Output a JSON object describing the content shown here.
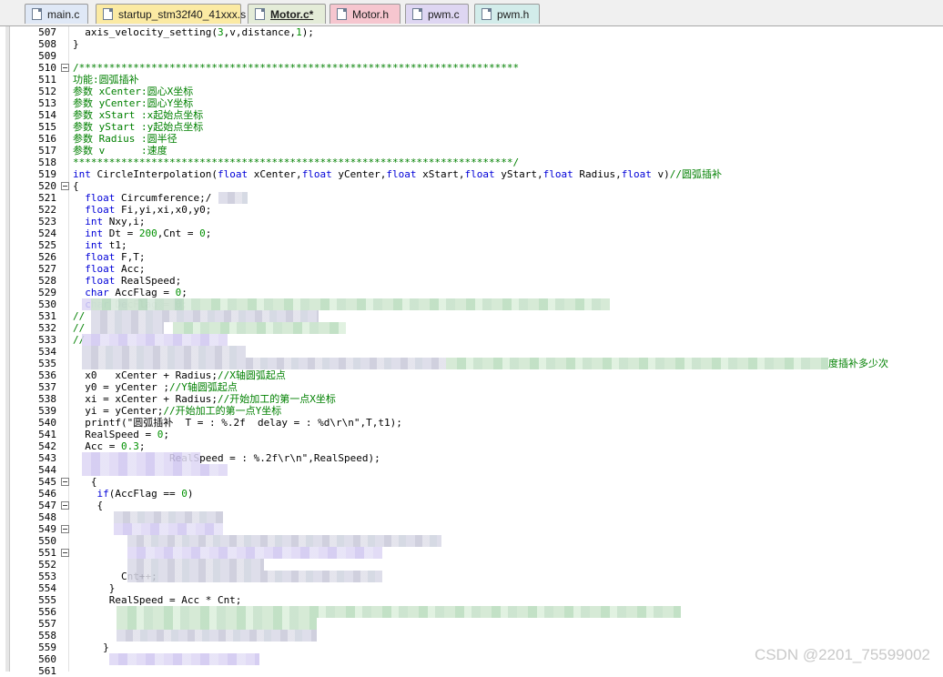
{
  "tabs": [
    {
      "label": "main.c",
      "bg": "#dfe8f6",
      "active": false
    },
    {
      "label": "startup_stm32f40_41xxx.s",
      "bg": "#fbeaa3",
      "active": false
    },
    {
      "label": "Motor.c*",
      "bg": "#e4ecd8",
      "active": true
    },
    {
      "label": "Motor.h",
      "bg": "#f6c6cf",
      "active": false
    },
    {
      "label": "pwm.c",
      "bg": "#ded6f2",
      "active": false
    },
    {
      "label": "pwm.h",
      "bg": "#d2ecea",
      "active": false
    }
  ],
  "lines": [
    {
      "n": "507",
      "fold": false,
      "html": "  axis_velocity_setting(<span class='num'>3</span>,v,distance,<span class='num'>1</span>);"
    },
    {
      "n": "508",
      "fold": false,
      "html": "}"
    },
    {
      "n": "509",
      "fold": false,
      "html": ""
    },
    {
      "n": "510",
      "fold": true,
      "html": "<span class='cm'>/*************************************************************************</span>"
    },
    {
      "n": "511",
      "fold": false,
      "html": "<span class='cm'>功能:圆弧插补</span>"
    },
    {
      "n": "512",
      "fold": false,
      "html": "<span class='cm'>参数 xCenter:圆心X坐标</span>"
    },
    {
      "n": "513",
      "fold": false,
      "html": "<span class='cm'>参数 yCenter:圆心Y坐标</span>"
    },
    {
      "n": "514",
      "fold": false,
      "html": "<span class='cm'>参数 xStart :x起始点坐标</span>"
    },
    {
      "n": "515",
      "fold": false,
      "html": "<span class='cm'>参数 yStart :y起始点坐标</span>"
    },
    {
      "n": "516",
      "fold": false,
      "html": "<span class='cm'>参数 Radius :圆半径</span>"
    },
    {
      "n": "517",
      "fold": false,
      "html": "<span class='cm'>参数 v      :速度</span>"
    },
    {
      "n": "518",
      "fold": false,
      "html": "<span class='cm'>*************************************************************************/</span>"
    },
    {
      "n": "519",
      "fold": false,
      "html": "<span class='kw'>int</span> CircleInterpolation(<span class='kw'>float</span> xCenter,<span class='kw'>float</span> yCenter,<span class='kw'>float</span> xStart,<span class='kw'>float</span> yStart,<span class='kw'>float</span> Radius,<span class='kw'>float</span> v)<span class='cm'>//圆弧插补</span>"
    },
    {
      "n": "520",
      "fold": true,
      "html": "{"
    },
    {
      "n": "521",
      "fold": false,
      "html": "  <span class='kw'>float</span> Circumference;/"
    },
    {
      "n": "522",
      "fold": false,
      "html": "  <span class='kw'>float</span> Fi,yi,xi,x0,y0;"
    },
    {
      "n": "523",
      "fold": false,
      "html": "  <span class='kw'>int</span> Nxy,i;"
    },
    {
      "n": "524",
      "fold": false,
      "html": "  <span class='kw'>int</span> Dt = <span class='num'>200</span>,Cnt = <span class='num'>0</span>;"
    },
    {
      "n": "525",
      "fold": false,
      "html": "  <span class='kw'>int</span> t1;"
    },
    {
      "n": "526",
      "fold": false,
      "html": "  <span class='kw'>float</span> F,T;"
    },
    {
      "n": "527",
      "fold": false,
      "html": "  <span class='kw'>float</span> Acc;"
    },
    {
      "n": "528",
      "fold": false,
      "html": "  <span class='kw'>float</span> RealSpeed;"
    },
    {
      "n": "529",
      "fold": false,
      "html": "  <span class='kw'>char</span> AccFlag = <span class='num'>0</span>;"
    },
    {
      "n": "530",
      "fold": false,
      "html": "  <span class='kw'>char</span> DecFlag = <span class='num'>0</span>;"
    },
    {
      "n": "531",
      "fold": false,
      "html": "<span class='cm'>//</span>"
    },
    {
      "n": "532",
      "fold": false,
      "html": "<span class='cm'>//</span>"
    },
    {
      "n": "533",
      "fold": false,
      "html": "<span class='cm'>//</span>"
    },
    {
      "n": "534",
      "fold": false,
      "html": ""
    },
    {
      "n": "535",
      "fold": false,
      "html": ""
    },
    {
      "n": "536",
      "fold": false,
      "html": "  x0   xCenter + Radius;<span class='cm'>//X轴圆弧起点</span>"
    },
    {
      "n": "537",
      "fold": false,
      "html": "  y0 = yCenter ;<span class='cm'>//Y轴圆弧起点</span>"
    },
    {
      "n": "538",
      "fold": false,
      "html": "  xi = xCenter + Radius;<span class='cm'>//开始加工的第一点X坐标</span>"
    },
    {
      "n": "539",
      "fold": false,
      "html": "  yi = yCenter;<span class='cm'>//开始加工的第一点Y坐标</span>"
    },
    {
      "n": "540",
      "fold": false,
      "html": "  printf(\"圆弧插补  T = : %.2f  delay = : %d\\r\\n\",T,t1);"
    },
    {
      "n": "541",
      "fold": false,
      "html": "  RealSpeed = <span class='num'>0</span>;"
    },
    {
      "n": "542",
      "fold": false,
      "html": "  Acc = <span class='num'>0.3</span>;"
    },
    {
      "n": "543",
      "fold": false,
      "html": "                RealSpeed = : %.2f\\r\\n\",RealSpeed);"
    },
    {
      "n": "544",
      "fold": false,
      "html": ""
    },
    {
      "n": "545",
      "fold": true,
      "html": "   {"
    },
    {
      "n": "546",
      "fold": false,
      "html": "    <span class='kw'>if</span>(AccFlag == <span class='num'>0</span>)"
    },
    {
      "n": "547",
      "fold": true,
      "html": "    {"
    },
    {
      "n": "548",
      "fold": false,
      "html": ""
    },
    {
      "n": "549",
      "fold": true,
      "html": ""
    },
    {
      "n": "550",
      "fold": false,
      "html": ""
    },
    {
      "n": "551",
      "fold": true,
      "html": ""
    },
    {
      "n": "552",
      "fold": false,
      "html": ""
    },
    {
      "n": "553",
      "fold": false,
      "html": "        Cnt++;"
    },
    {
      "n": "554",
      "fold": false,
      "html": "      }"
    },
    {
      "n": "555",
      "fold": false,
      "html": "      RealSpeed = Acc * Cnt;"
    },
    {
      "n": "556",
      "fold": false,
      "html": ""
    },
    {
      "n": "557",
      "fold": false,
      "html": ""
    },
    {
      "n": "558",
      "fold": false,
      "html": ""
    },
    {
      "n": "559",
      "fold": false,
      "html": "     }"
    },
    {
      "n": "560",
      "fold": false,
      "html": ""
    },
    {
      "n": "561",
      "fold": false,
      "html": ""
    }
  ],
  "line535_tail": "度插补多少次",
  "watermark": "CSDN @2201_75599002"
}
